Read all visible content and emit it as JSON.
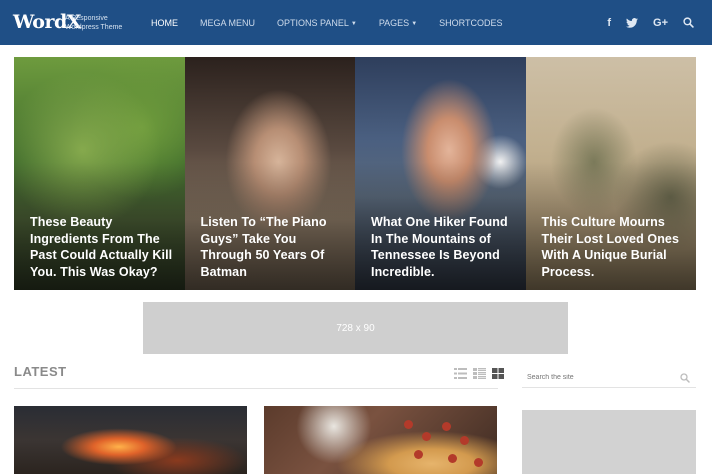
{
  "header": {
    "logo": "WordX",
    "tagline": "A Responsive Wordpress Theme",
    "nav": [
      {
        "label": "HOME",
        "active": true,
        "dropdown": false
      },
      {
        "label": "MEGA MENU",
        "active": false,
        "dropdown": false
      },
      {
        "label": "OPTIONS PANEL",
        "active": false,
        "dropdown": true
      },
      {
        "label": "PAGES",
        "active": false,
        "dropdown": true
      },
      {
        "label": "SHORTCODES",
        "active": false,
        "dropdown": false
      }
    ],
    "social": [
      "facebook-icon",
      "twitter-icon",
      "google-plus-icon",
      "search-icon"
    ],
    "social_labels": {
      "facebook": "f",
      "gplus": "G+"
    },
    "colors": {
      "bar": "#1f4f86",
      "text": "#ffffff"
    }
  },
  "hero": {
    "cards": [
      {
        "title": "These Beauty Ingredients From The Past Could Actually Kill You. This Was Okay?"
      },
      {
        "title": "Listen To “The Piano Guys” Take You Through 50 Years Of Batman"
      },
      {
        "title": "What One Hiker Found In The Mountains of Tennessee Is Beyond Incredible."
      },
      {
        "title": "This Culture Mourns Their Lost Loved Ones With A Unique Burial Process."
      }
    ]
  },
  "ad": {
    "label": "728 x 90"
  },
  "latest": {
    "title": "LATEST",
    "view_icons": [
      "list-view-icon",
      "compact-list-icon",
      "grid-view-icon"
    ]
  },
  "sidebar": {
    "search_placeholder": "Search the site"
  }
}
